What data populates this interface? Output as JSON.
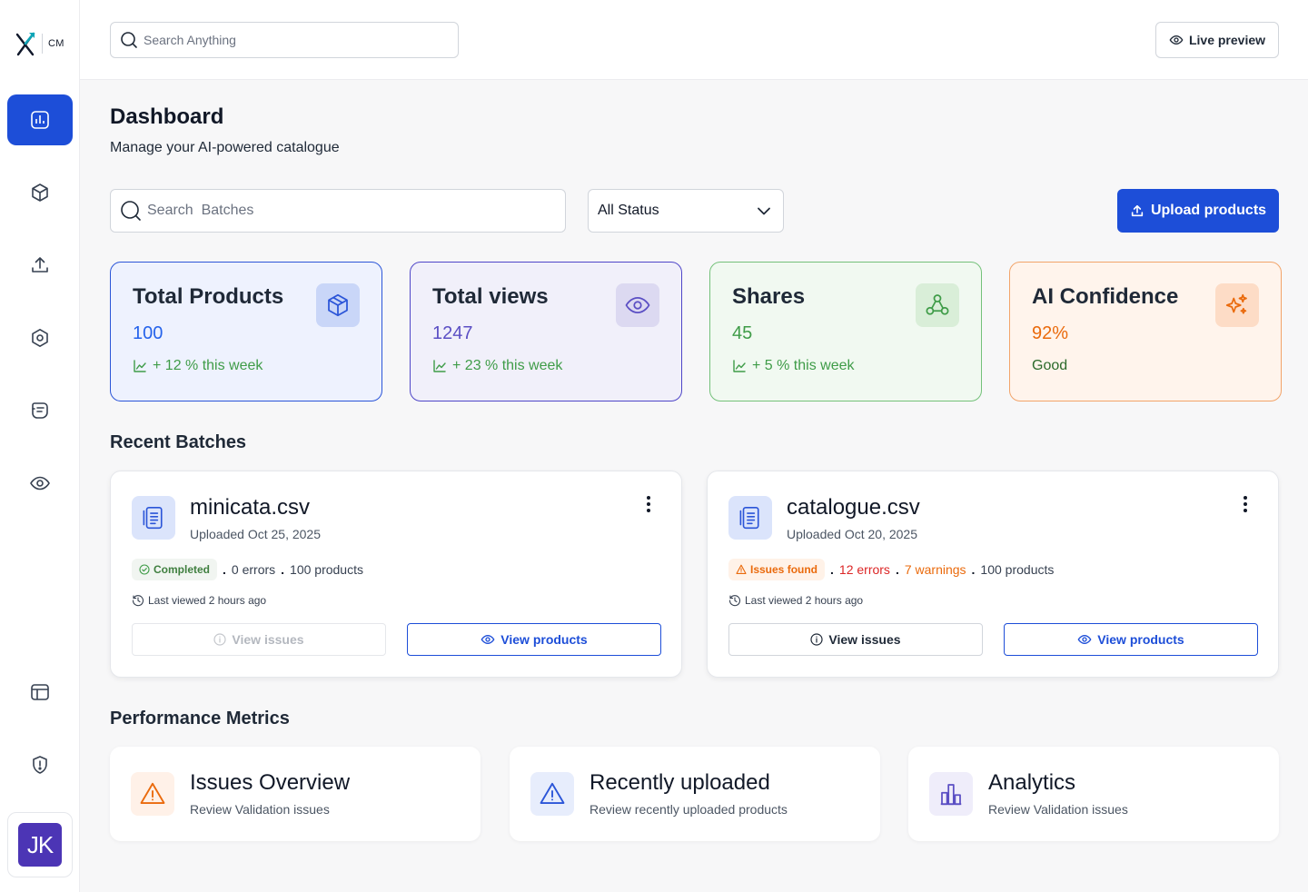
{
  "brand": {
    "logo_text": "CM"
  },
  "topbar": {
    "search_placeholder": "Search Anything",
    "live_preview_label": "Live preview"
  },
  "sidebar": {
    "items": [
      {
        "name": "dashboard",
        "icon": "chart-icon",
        "active": true
      },
      {
        "name": "products",
        "icon": "box-icon",
        "active": false
      },
      {
        "name": "upload",
        "icon": "upload-icon",
        "active": false
      },
      {
        "name": "validation",
        "icon": "hexagon-icon",
        "active": false
      },
      {
        "name": "ai",
        "icon": "badge-icon",
        "active": false
      },
      {
        "name": "preview",
        "icon": "eye-icon",
        "active": false
      },
      {
        "name": "templates",
        "icon": "layout-icon",
        "active": false
      },
      {
        "name": "security",
        "icon": "shield-icon",
        "active": false
      }
    ],
    "avatar_initials": "JK"
  },
  "header": {
    "title": "Dashboard",
    "subtitle": "Manage your AI-powered catalogue"
  },
  "filters": {
    "batch_search_placeholder": "Search  Batches",
    "status_value": "All Status",
    "upload_label": "Upload products"
  },
  "stats": [
    {
      "title": "Total Products",
      "value": "100",
      "trend": "+ 12 % this week",
      "color": "#2563eb",
      "bg": "#eef2fe",
      "border": "#2b55d8",
      "icon": "box-icon"
    },
    {
      "title": "Total views",
      "value": "1247",
      "trend": "+ 23 % this week",
      "color": "#5b4fc4",
      "bg": "#f1f0fa",
      "border": "#4f46c8",
      "icon": "eye-icon"
    },
    {
      "title": "Shares",
      "value": "45",
      "trend": "+ 5 % this week",
      "color": "#3f9c48",
      "bg": "#f1f9f1",
      "border": "#74c17a",
      "icon": "share-icon"
    },
    {
      "title": "AI Confidence",
      "value": "92%",
      "trend": "Good",
      "color": "#ea6a0c",
      "bg": "#fff4ec",
      "border": "#f2a46a",
      "icon": "sparkle-icon"
    }
  ],
  "recent_batches": {
    "title": "Recent Batches",
    "items": [
      {
        "file": "minicata.csv",
        "uploaded": "Uploaded Oct 25, 2025",
        "status": "Completed",
        "errors": "0 errors",
        "warnings": "",
        "products": "100 products",
        "last_viewed": "Last viewed 2 hours ago",
        "issues_label": "View issues",
        "products_label": "View products"
      },
      {
        "file": "catalogue.csv",
        "uploaded": "Uploaded Oct 20, 2025",
        "status": "Issues found",
        "errors": "12 errors",
        "warnings": "7 warnings",
        "products": "100 products",
        "last_viewed": "Last viewed 2 hours ago",
        "issues_label": "View issues",
        "products_label": "View products"
      }
    ]
  },
  "performance": {
    "title": "Performance Metrics",
    "items": [
      {
        "title": "Issues Overview",
        "sub": "Review Validation issues",
        "icon": "warning-triangle-icon"
      },
      {
        "title": "Recently uploaded",
        "sub": "Review recently uploaded products",
        "icon": "alert-triangle-icon"
      },
      {
        "title": "Analytics",
        "sub": "Review Validation issues",
        "icon": "bar-chart-icon"
      }
    ]
  },
  "colors": {
    "primary": "#1d4ed8",
    "success": "#3f9c48",
    "warning": "#ea6a0c",
    "error": "#dc2626"
  }
}
